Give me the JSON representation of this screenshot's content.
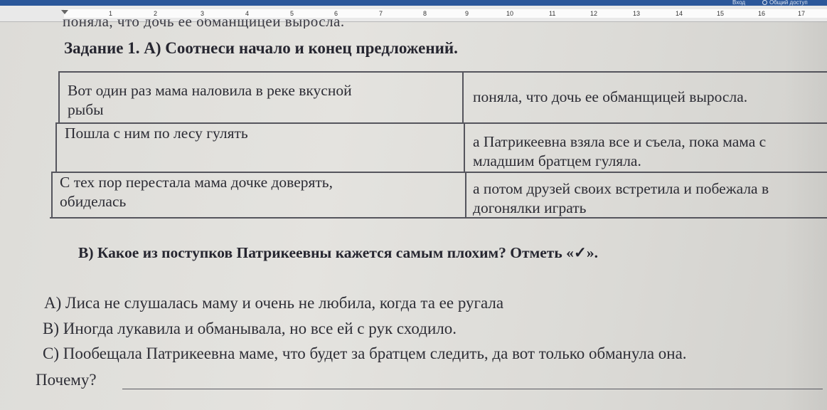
{
  "app": {
    "signin_label": "Вход",
    "share_label": "Общий доступ",
    "ribbon_color": "#2b579a"
  },
  "ruler": {
    "numbers": [
      "1",
      "2",
      "3",
      "4",
      "5",
      "6",
      "7",
      "8",
      "9",
      "10",
      "11",
      "12",
      "13",
      "14",
      "15",
      "16",
      "17"
    ]
  },
  "doc": {
    "cut_line": "поняла, что дочь ее обманщицей выросла.",
    "heading": "Задание 1.  А) Соотнеси начало и конец предложений.",
    "table": {
      "left": [
        [
          "Вот один раз мама наловила в реке вкусной",
          "рыбы"
        ],
        [
          "Пошла с ним по лесу гулять"
        ],
        [
          "С тех пор перестала мама дочке доверять,",
          "обиделась"
        ]
      ],
      "right": [
        [
          "поняла, что дочь ее обманщицей выросла."
        ],
        [
          "а Патрикеевна взяла все и съела, пока мама с",
          "младшим братцем гуляла."
        ],
        [
          "а потом друзей своих встретила и побежала в",
          "догонялки играть"
        ]
      ]
    },
    "question_b": "В) Какое из поступков Патрикеевны кажется самым плохим? Отметь «✓».",
    "options": [
      "А) Лиса не слушалась маму и очень не любила, когда та ее ругала",
      "В) Иногда лукавила и обманывала, но все ей с рук сходило.",
      "С) Пообещала Патрикеевна маме, что будет за братцем следить, да вот только обманула она."
    ],
    "why_label": "Почему?"
  }
}
